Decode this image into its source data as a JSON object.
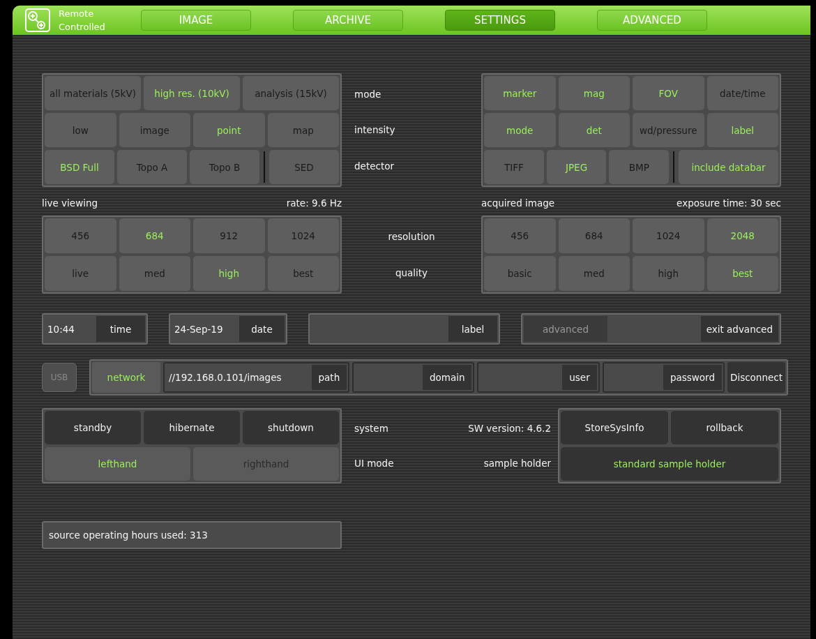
{
  "header": {
    "title": "Remote Controlled"
  },
  "tabs": [
    {
      "label": "IMAGE",
      "selected": false
    },
    {
      "label": "ARCHIVE",
      "selected": false
    },
    {
      "label": "SETTINGS",
      "selected": true
    },
    {
      "label": "ADVANCED",
      "selected": false
    }
  ],
  "acquisition": {
    "left_rows": [
      [
        {
          "label": "all materials (5kV)",
          "selected": false
        },
        {
          "label": "high res. (10kV)",
          "selected": true
        },
        {
          "label": "analysis (15kV)",
          "selected": false
        }
      ],
      [
        {
          "label": "low",
          "selected": false
        },
        {
          "label": "image",
          "selected": false
        },
        {
          "label": "point",
          "selected": true
        },
        {
          "label": "map",
          "selected": false
        }
      ],
      [
        {
          "label": "BSD Full",
          "selected": true
        },
        {
          "label": "Topo A",
          "selected": false
        },
        {
          "label": "Topo B",
          "selected": false
        },
        {
          "label": "SED",
          "selected": false,
          "divider_before": true
        }
      ]
    ],
    "row_labels": [
      "mode",
      "intensity",
      "detector"
    ],
    "right_rows": [
      [
        {
          "label": "marker",
          "selected": true
        },
        {
          "label": "mag",
          "selected": true
        },
        {
          "label": "FOV",
          "selected": true
        },
        {
          "label": "date/time",
          "selected": false
        }
      ],
      [
        {
          "label": "mode",
          "selected": true
        },
        {
          "label": "det",
          "selected": true
        },
        {
          "label": "wd/pressure",
          "selected": false
        },
        {
          "label": "label",
          "selected": true
        }
      ],
      [
        {
          "label": "TIFF",
          "selected": false
        },
        {
          "label": "JPEG",
          "selected": true
        },
        {
          "label": "BMP",
          "selected": false
        },
        {
          "label": "include databar",
          "selected": true,
          "divider_before": true,
          "wide": true
        }
      ]
    ]
  },
  "info_left": {
    "label": "live viewing",
    "value": "rate: 9.6 Hz"
  },
  "info_right": {
    "label": "acquired image",
    "value": "exposure time: 30 sec"
  },
  "image_settings": {
    "left_rows": [
      [
        {
          "label": "456",
          "selected": false
        },
        {
          "label": "684",
          "selected": true
        },
        {
          "label": "912",
          "selected": false
        },
        {
          "label": "1024",
          "selected": false
        }
      ],
      [
        {
          "label": "live",
          "selected": false
        },
        {
          "label": "med",
          "selected": false
        },
        {
          "label": "high",
          "selected": true
        },
        {
          "label": "best",
          "selected": false
        }
      ]
    ],
    "row_labels": [
      "resolution",
      "quality"
    ],
    "right_rows": [
      [
        {
          "label": "456",
          "selected": false
        },
        {
          "label": "684",
          "selected": false
        },
        {
          "label": "1024",
          "selected": false
        },
        {
          "label": "2048",
          "selected": true
        }
      ],
      [
        {
          "label": "basic",
          "selected": false
        },
        {
          "label": "med",
          "selected": false
        },
        {
          "label": "high",
          "selected": false
        },
        {
          "label": "best",
          "selected": true
        }
      ]
    ]
  },
  "time": {
    "value": "10:44",
    "label": "time"
  },
  "date": {
    "value": "24-Sep-19",
    "label": "date"
  },
  "label_field": {
    "label": "label"
  },
  "advanced": {
    "label": "advanced",
    "exit_label": "exit advanced"
  },
  "network": {
    "usb": {
      "label": "USB",
      "disabled": true
    },
    "toggle": {
      "label": "network",
      "selected": true
    },
    "fields": [
      {
        "value": "//192.168.0.101/images",
        "label": "path"
      },
      {
        "label": "domain"
      },
      {
        "label": "user"
      },
      {
        "label": "password"
      }
    ],
    "disconnect": "Disconnect"
  },
  "system": {
    "rows": [
      [
        {
          "label": "standby",
          "kind": "action"
        },
        {
          "label": "hibernate",
          "kind": "action"
        },
        {
          "label": "shutdown",
          "kind": "action"
        }
      ],
      [
        {
          "label": "lefthand",
          "kind": "toggle",
          "selected": true
        },
        {
          "label": "righthand",
          "kind": "toggle",
          "selected": false
        }
      ]
    ],
    "labels": [
      {
        "label": "system",
        "value": "SW version: 4.6.2"
      },
      {
        "label": "UI mode",
        "value": "sample holder"
      }
    ],
    "right_rows": [
      [
        {
          "label": "StoreSysInfo",
          "kind": "action"
        },
        {
          "label": "rollback",
          "kind": "action"
        }
      ],
      [
        {
          "label": "standard sample holder",
          "kind": "action",
          "selected": true
        }
      ]
    ]
  },
  "status": "source operating hours used: 313"
}
